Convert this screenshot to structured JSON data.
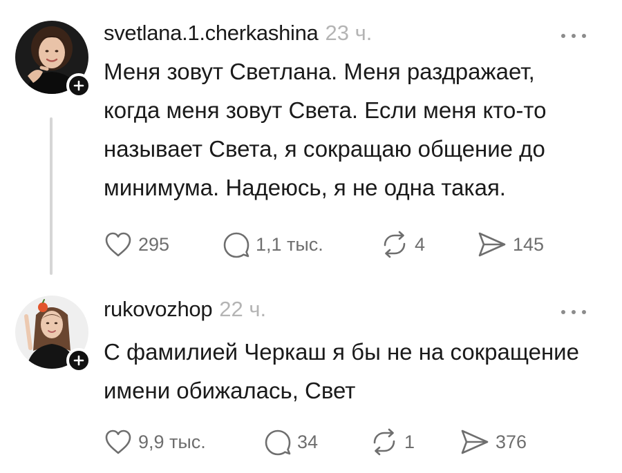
{
  "posts": [
    {
      "username": "svetlana.1.cherkashina",
      "time": "23 ч.",
      "text": "Меня зовут Светлана. Меня раздражает, когда меня зовут Света. Если меня кто-то называет Света, я сокращаю общение до минимума. Надеюсь, я не одна такая.",
      "likes": "295",
      "replies": "1,1 тыс.",
      "reposts": "4",
      "shares": "145"
    },
    {
      "username": "rukovozhop",
      "time": "22 ч.",
      "text": "С фамилией Черкаш я бы не на сокращение имени обижалась, Свет",
      "likes": "9,9 тыс.",
      "replies": "34",
      "reposts": "1",
      "shares": "376"
    }
  ],
  "icons": {
    "like": "heart-icon",
    "reply": "speech-bubble-icon",
    "repost": "repost-icon",
    "share": "send-icon",
    "more": "more-dots-icon",
    "follow": "plus-icon"
  },
  "colors": {
    "text": "#1a1a1a",
    "muted": "#b4b4b4",
    "icon": "#6e6e6e",
    "badge": "#111111",
    "thread_line": "#d6d6d6"
  }
}
